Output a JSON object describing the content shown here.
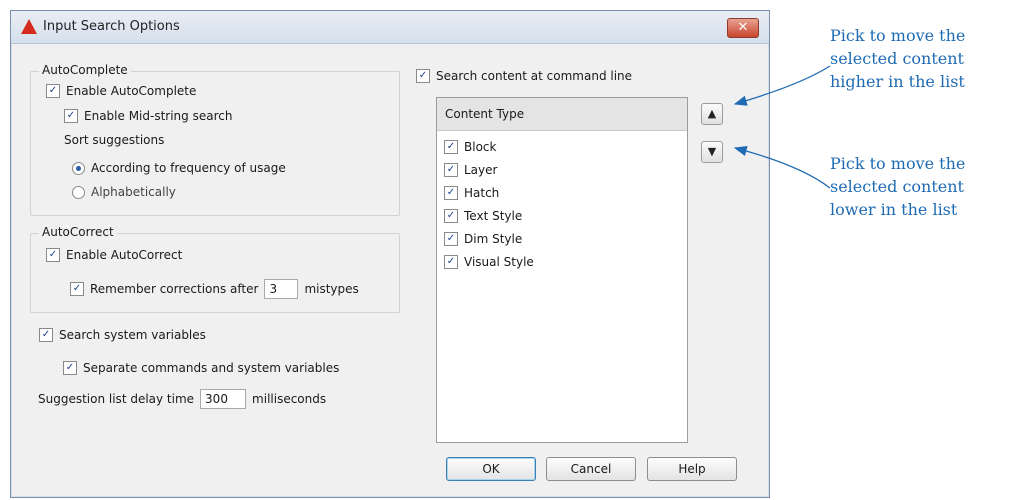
{
  "dialog": {
    "title": "Input Search Options",
    "close_glyph": "✕",
    "icon": "autocad-triangle-icon"
  },
  "autocomplete": {
    "group_label": "AutoComplete",
    "enable_label": "Enable AutoComplete",
    "enable_checked": true,
    "midstring_label": "Enable Mid-string search",
    "midstring_checked": true,
    "sort_label": "Sort suggestions",
    "sort_options": [
      "According to frequency of usage",
      "Alphabetically"
    ],
    "sort_selected": "According to frequency of usage"
  },
  "autocorrect": {
    "group_label": "AutoCorrect",
    "enable_label": "Enable AutoCorrect",
    "enable_checked": true,
    "remember_label": "Remember corrections after",
    "remember_value": "3",
    "remember_suffix": "mistypes",
    "remember_checked": true
  },
  "sysvars": {
    "search_label": "Search system variables",
    "search_checked": true,
    "separate_label": "Separate commands and system variables",
    "separate_checked": true
  },
  "delay": {
    "label": "Suggestion list delay time",
    "value": "300",
    "unit": "milliseconds"
  },
  "search_content": {
    "label": "Search content at command line",
    "checked": true,
    "list_header": "Content Type",
    "items": [
      "Block",
      "Layer",
      "Hatch",
      "Text Style",
      "Dim Style",
      "Visual Style"
    ],
    "items_checked": [
      true,
      true,
      true,
      true,
      true,
      true
    ],
    "move_up_glyph": "▲",
    "move_down_glyph": "▼"
  },
  "buttons": {
    "ok": "OK",
    "cancel": "Cancel",
    "help": "Help"
  },
  "annotations": {
    "move_up": [
      "Pick to move the",
      "selected content",
      "higher in the list"
    ],
    "move_down": [
      "Pick to move the",
      "selected content",
      "lower in the list"
    ],
    "color": "#1f6bb3"
  },
  "check_glyph": "✓"
}
